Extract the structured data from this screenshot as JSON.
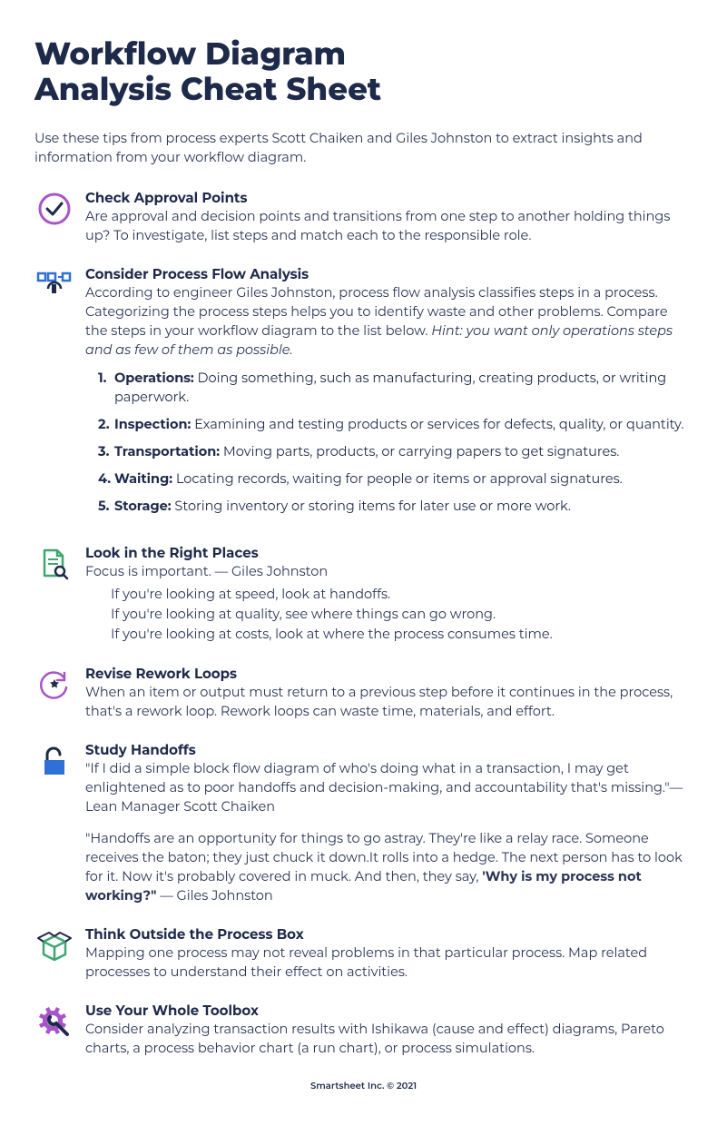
{
  "title_line1": "Workflow Diagram",
  "title_line2": "Analysis Cheat Sheet",
  "intro": "Use these tips from process experts Scott Chaiken and Giles Johnston to extract insights and information from your workflow diagram.",
  "sections": {
    "approval": {
      "title": "Check Approval Points",
      "body": "Are approval and decision points and transitions from one step to another holding things up? To investigate, list steps and match each to the responsible role."
    },
    "flow": {
      "title": "Consider Process Flow Analysis",
      "body_pre": "According to engineer Giles Johnston, process flow analysis classifies steps in a process. Categorizing the process steps helps you to identify waste and other problems. Compare the steps in your workflow diagram to the list below. ",
      "hint": "Hint: you want only operations steps and as few of them as possible.",
      "items": [
        {
          "n": "1.",
          "label": "Operations:",
          "text": " Doing something, such as manufacturing, creating products, or writing paperwork."
        },
        {
          "n": "2.",
          "label": "Inspection:",
          "text": " Examining and testing products or services for defects, quality, or quantity."
        },
        {
          "n": "3.",
          "label": "Transportation:",
          "text": " Moving parts, products, or carrying papers to get signatures."
        },
        {
          "n": "4.",
          "label": "Waiting:",
          "text": " Locating records, waiting for people or items or approval signatures."
        },
        {
          "n": "5.",
          "label": "Storage:",
          "text": " Storing inventory or storing items for later use or more work."
        }
      ]
    },
    "places": {
      "title": "Look in the Right Places",
      "lead": "Focus is important. — Giles Johnston",
      "lines": [
        "If you're looking at speed, look at handoffs.",
        "If you're looking at quality, see where things can go wrong.",
        "If you're looking at costs, look at where the process consumes time."
      ]
    },
    "rework": {
      "title": "Revise Rework Loops",
      "body": "When an item or output must return to a previous step before it continues in the process, that's a rework loop. Rework loops can waste time, materials, and effort."
    },
    "handoffs": {
      "title": "Study Handoffs",
      "p1": "\"If I did a simple block flow diagram of who's doing what in a transaction, I may get enlightened as to poor handoffs and decision-making, and accountability that's missing.\"— Lean Manager Scott Chaiken",
      "p2_pre": "\"Handoffs are an opportunity for things to go astray. They're like a relay race. Someone receives the baton; they just chuck it down.It rolls into a hedge. The next person has to look for it. Now it's probably covered in muck. And then, they say, ",
      "p2_bold": "'Why is my process not working?\"",
      "p2_post": " — Giles Johnston"
    },
    "box": {
      "title": "Think Outside the Process Box",
      "body": "Mapping one process may not reveal problems in that particular process. Map related processes to understand their effect on activities."
    },
    "toolbox": {
      "title": "Use Your Whole Toolbox",
      "body": "Consider analyzing transaction results with Ishikawa (cause and effect) diagrams, Pareto charts, a process behavior chart (a run chart), or process simulations."
    }
  },
  "footer": "Smartsheet Inc. © 2021"
}
